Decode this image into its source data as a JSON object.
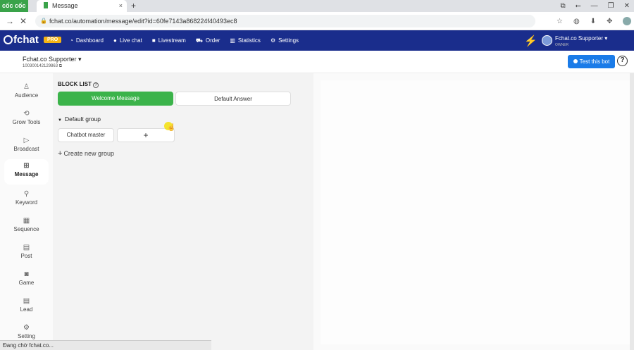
{
  "browser": {
    "brand": "cốc cốc",
    "tab_title": "Message",
    "tab_close": "×",
    "new_tab": "+",
    "url": "fchat.co/automation/message/edit?id=60fe7143a868224f40493ec8",
    "window_controls": [
      "⧉",
      "⭠",
      "—",
      "❐",
      "✕"
    ],
    "toolbar_icons": [
      "☆",
      "◍",
      "⬇",
      "✥",
      "avatar",
      "⤓"
    ],
    "back": "→",
    "stop": "✕"
  },
  "app": {
    "logo": "fchat",
    "plan_badge": "PRO",
    "nav": [
      {
        "label": "Dashboard",
        "icon": "dashboard-icon",
        "glyph": "◔"
      },
      {
        "label": "Live chat",
        "icon": "chat-bubble-icon",
        "glyph": "●"
      },
      {
        "label": "Livestream",
        "icon": "video-camera-icon",
        "glyph": "■"
      },
      {
        "label": "Order",
        "icon": "cart-icon",
        "glyph": "⛟"
      },
      {
        "label": "Statistics",
        "icon": "bar-chart-icon",
        "glyph": "▥"
      },
      {
        "label": "Settings",
        "icon": "gear-icon",
        "glyph": "⚙"
      }
    ],
    "user": {
      "name": "Fchat.co Supporter ▾",
      "role": "OWNER"
    }
  },
  "page": {
    "name": "Fchat.co Supporter ▾",
    "id": "100300142129863 ⧉",
    "test_button": "Test this bot",
    "help": "?"
  },
  "sidebar": {
    "items": [
      {
        "label": "Audience",
        "icon": "audience-icon",
        "glyph": "♙"
      },
      {
        "label": "Grow Tools",
        "icon": "grow-tools-icon",
        "glyph": "⟲"
      },
      {
        "label": "Broadcast",
        "icon": "broadcast-icon",
        "glyph": "▷"
      },
      {
        "label": "Message",
        "icon": "message-icon",
        "glyph": "⊞"
      },
      {
        "label": "Keyword",
        "icon": "keyword-icon",
        "glyph": "⚲"
      },
      {
        "label": "Sequence",
        "icon": "sequence-icon",
        "glyph": "▦"
      },
      {
        "label": "Post",
        "icon": "post-icon",
        "glyph": "▤"
      },
      {
        "label": "Game",
        "icon": "game-icon",
        "glyph": "◙"
      },
      {
        "label": "Lead",
        "icon": "lead-icon",
        "glyph": "▤"
      },
      {
        "label": "Setting",
        "icon": "setting-icon",
        "glyph": "⚙"
      }
    ],
    "active": "Message"
  },
  "blocklist": {
    "title": "BLOCK LIST",
    "help": "?",
    "tabs": [
      "Welcome Message",
      "Default Answer"
    ],
    "group": {
      "caret": "▼",
      "name": "Default group",
      "blocks": [
        "Chatbot master"
      ],
      "add_label": "+"
    },
    "create_group": "Create new group",
    "create_plus": "+"
  },
  "status": "Đang chờ fchat.co...",
  "colors": {
    "nav_bg": "#1a2d8c",
    "accent_green": "#3bb34a",
    "button_blue": "#1a7be8",
    "pro_badge": "#f5b414"
  }
}
